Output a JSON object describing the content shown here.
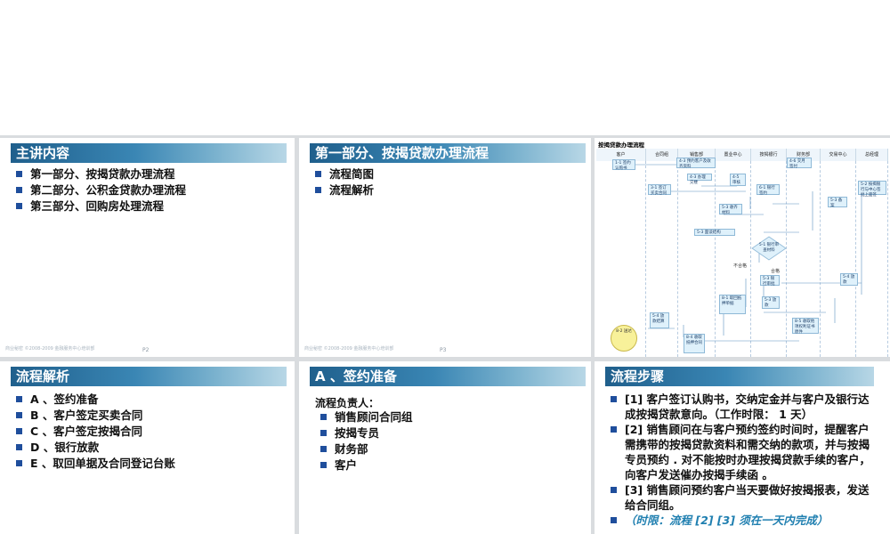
{
  "slides": {
    "s1": {
      "title": "主讲内容",
      "items": [
        "第一部分、按揭贷款办理流程",
        "第二部分、公积金贷款办理流程",
        "第三部分、回购房处理流程"
      ],
      "footer": "商业秘密 ©2008-2009 金融服务中心培训部",
      "page": "P2"
    },
    "s2": {
      "title": "第一部分、按揭贷款办理流程",
      "items": [
        "流程简图",
        "流程解析"
      ],
      "footer": "商业秘密 ©2008-2009 金融服务中心培训部",
      "page": "P3"
    },
    "s3": {
      "chart_title": "按揭贷款办理流程",
      "columns": [
        "客户",
        "合同组",
        "销售部",
        "置业中心",
        "按揭银行",
        "财务部",
        "交易中心",
        "总经理"
      ],
      "boxes": {
        "b1": "1-1 签约认购书",
        "b2": "4-3 预约客户及收齐资料",
        "b3": "4-3 办理交楼",
        "b4": "3-1 签订买卖合同",
        "b5": "4-5 审核",
        "b6": "4-6 交月签付",
        "b7": "6-1 银行签约",
        "b8": "5-2 按揭银行与中心签批上面签",
        "b9": "5-3 收齐材料",
        "b10": "5-3 备案",
        "b11": "5-3 面谈结构",
        "b12": "5-3 银行审批",
        "b13": "5-4 放款",
        "b14": "5-3 放款",
        "b15": "8-1 取回抵押单据",
        "b16": "5-4 放款结算",
        "b17": "8-2 送达",
        "b18": "8-4 收取抵押合同",
        "b19": "8-5 收取他项权利证书原件"
      },
      "diamond": "5-1 银行审查材料",
      "labels": {
        "no": "不合格",
        "yes": "合格"
      }
    },
    "s4": {
      "title": "流程解析",
      "items": [
        "A 、签约准备",
        "B 、客户签定买卖合同",
        "C 、客户签定按揭合同",
        "D 、银行放款",
        "E 、取回单据及合同登记台账"
      ]
    },
    "s5": {
      "title": "A 、签约准备",
      "intro": "流程负责人：",
      "items": [
        "销售顾问合同组",
        "按揭专员",
        "财务部",
        "客户"
      ]
    },
    "s6": {
      "title": "流程步骤",
      "steps": [
        "[1] 客户签订认购书，交纳定金并与客户及银行达成按揭贷款意向。（工作时限： 1 天）",
        "[2]  销售顾问在与客户预约签约时间时，提醒客户需携带的按揭贷款资料和需交纳的款项，并与按揭专员预约 . 对不能按时办理按揭贷款手续的客户，向客户发送催办按揭手续函 。",
        "[3] 销售顾问预约客户当天要做好按揭报表，发送给合同组。",
        "（时限：流程 [2] [3] 须在一天内完成）"
      ]
    }
  }
}
